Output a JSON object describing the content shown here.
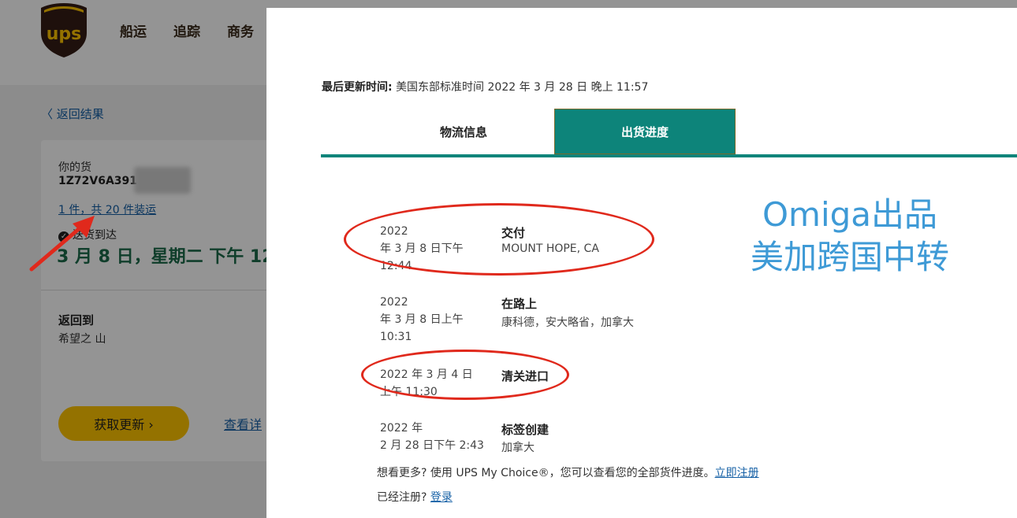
{
  "background": {
    "nav_items": [
      "船运",
      "追踪",
      "商务"
    ],
    "back_link": "〈 返回结果",
    "your_shipment": "你的货",
    "tracking_number": "1Z72V6A391",
    "package_link": "1 件，共 20 件装运",
    "delivered_label": "送货到达",
    "delivered_date": "3 月 8 日，星期二 下午 12",
    "return_to_label": "返回到",
    "return_to_place": "希望之 山",
    "get_updates_button": "获取更新 ›",
    "view_details_link": "查看详"
  },
  "modal": {
    "last_update_label": "最后更新时间:",
    "last_update_value": "美国东部标准时间 2022 年 3 月 28 日 晚上 11:57",
    "tabs": [
      {
        "label": "物流信息",
        "active": false
      },
      {
        "label": "出货进度",
        "active": true
      }
    ],
    "events": [
      {
        "date_lines": [
          "2022",
          "年 3 月 8 日下午",
          "12:44"
        ],
        "title": "交付",
        "location": "MOUNT HOPE, CA"
      },
      {
        "date_lines": [
          "2022",
          "年 3 月 8 日上午",
          "10:31"
        ],
        "title": "在路上",
        "location": "康科德，安大略省，加拿大"
      },
      {
        "date_lines": [
          "2022 年 3 月 4 日",
          "上午 11:30"
        ],
        "title": "清关进口",
        "location": ""
      },
      {
        "date_lines": [
          "2022 年",
          "2 月 28 日下午 2:43"
        ],
        "title": "标签创建",
        "location": "加拿大"
      }
    ],
    "promo_text": "想看更多? 使用 UPS My Choice®，您可以查看您的全部货件进度。",
    "promo_link": "立即注册",
    "login_text": "已经注册? ",
    "login_link": "登录"
  },
  "watermark": {
    "line1": "Omiga出品",
    "line2": "美加跨国中转"
  },
  "colors": {
    "brand_brown": "#351c15",
    "brand_gold": "#ffc400",
    "teal": "#0d847a",
    "link": "#1560a6",
    "annotation_red": "#e0291c",
    "watermark_blue": "#3e9ad6"
  }
}
